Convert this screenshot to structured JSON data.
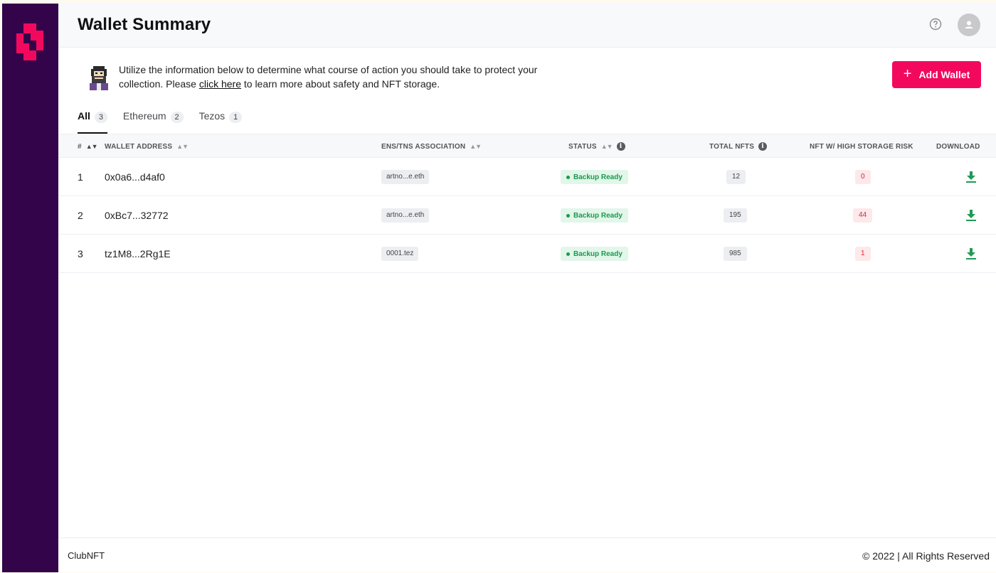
{
  "brand": {
    "accent": "#f2095d",
    "sidebar_bg": "#34044a",
    "logo_icon": "clubnft-logo-icon"
  },
  "header": {
    "title": "Wallet Summary",
    "help_icon": "question-circle-icon",
    "avatar_icon": "user-avatar-icon"
  },
  "info": {
    "icon": "pixel-character-icon",
    "text_before": "Utilize the information below to determine what course of action you should take to protect your collection. Please ",
    "link_text": "click here",
    "text_after": " to learn more about safety and NFT storage."
  },
  "add_wallet": {
    "label": "Add Wallet",
    "icon": "plus-icon"
  },
  "tabs": [
    {
      "label": "All",
      "count": "3",
      "active": true
    },
    {
      "label": "Ethereum",
      "count": "2",
      "active": false
    },
    {
      "label": "Tezos",
      "count": "1",
      "active": false
    }
  ],
  "table": {
    "columns": {
      "index": "#",
      "address": "WALLET ADDRESS",
      "ens": "ENS/TNS ASSOCIATION",
      "status": "STATUS",
      "total": "TOTAL NFTS",
      "risk": "NFT W/ HIGH STORAGE RISK",
      "download": "DOWNLOAD"
    },
    "rows": [
      {
        "index": "1",
        "address": "0x0a6...d4af0",
        "ens": "artno...e.eth",
        "status": "Backup Ready",
        "total": "12",
        "risk": "0"
      },
      {
        "index": "2",
        "address": "0xBc7...32772",
        "ens": "artno...e.eth",
        "status": "Backup Ready",
        "total": "195",
        "risk": "44"
      },
      {
        "index": "3",
        "address": "tz1M8...2Rg1E",
        "ens": "0001.tez",
        "status": "Backup Ready",
        "total": "985",
        "risk": "1"
      }
    ],
    "download_icon": "download-icon"
  },
  "footer": {
    "left": "ClubNFT",
    "right": "© 2022 | All Rights Reserved"
  }
}
